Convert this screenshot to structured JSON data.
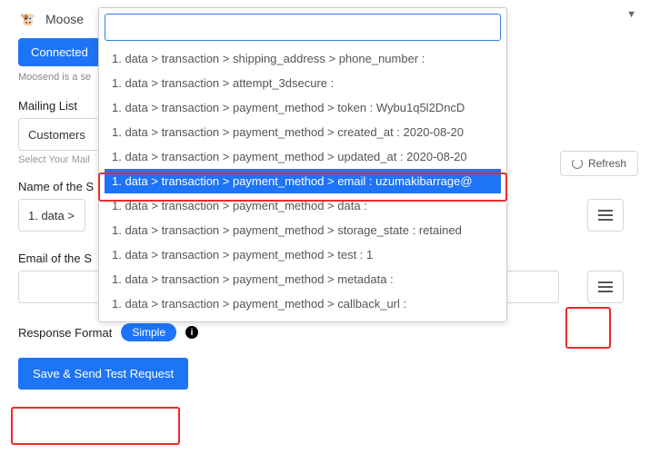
{
  "header": {
    "app_name": "Moose",
    "logo_glyph": "🐮"
  },
  "connected": {
    "label": "Connected"
  },
  "helper": "Moosend is a se",
  "mailing_list": {
    "label": "Mailing List",
    "value": "Customers",
    "hint": "Select Your Mail"
  },
  "refresh": {
    "label": "Refresh"
  },
  "name_field": {
    "label": "Name of the S",
    "value": "1. data > t"
  },
  "email_field": {
    "label": "Email of the S",
    "value": ""
  },
  "response_format": {
    "label": "Response Format",
    "badge": "Simple"
  },
  "save": {
    "label": "Save & Send Test Request"
  },
  "dropdown": {
    "search_value": "",
    "selected_index": 5,
    "items": [
      "1. data > transaction > shipping_address > phone_number :",
      "1. data > transaction > attempt_3dsecure :",
      "1. data > transaction > payment_method > token : Wybu1q5l2DncD",
      "1. data > transaction > payment_method > created_at : 2020-08-20",
      "1. data > transaction > payment_method > updated_at : 2020-08-20",
      "1. data > transaction > payment_method > email : uzumakibarrage@",
      "1. data > transaction > payment_method > data :",
      "1. data > transaction > payment_method > storage_state : retained",
      "1. data > transaction > payment_method > test : 1",
      "1. data > transaction > payment_method > metadata :",
      "1. data > transaction > payment_method > callback_url :"
    ]
  }
}
